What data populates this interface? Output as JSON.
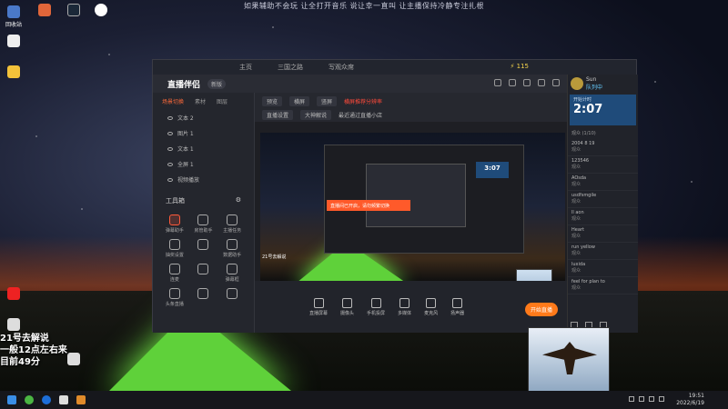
{
  "banner": "如果辅助不会玩 让全打开音乐 说让幸一直叫 让主播保持冷静专注扎根",
  "overlay": {
    "line1": "21号去解说",
    "line2": "一般12点左右来",
    "line3": "目前49分"
  },
  "desktop_icons": [
    {
      "name": "回收站"
    },
    {
      "name": ""
    },
    {
      "name": ""
    },
    {
      "name": ""
    }
  ],
  "app": {
    "title": "直播伴侣",
    "version": "新版",
    "top_tabs": [
      "主页",
      "三国之路",
      "写观众席"
    ],
    "coins": "115",
    "left_tabs": [
      "场景切换",
      "素材",
      "图层"
    ],
    "scenes": [
      "文本 2",
      "图片 1",
      "文本 1",
      "全屏 1",
      "视频播放"
    ],
    "tools_title": "工具箱",
    "tools": [
      {
        "label": "弹幕助手",
        "hot": true
      },
      {
        "label": "房管助手",
        "hot": false
      },
      {
        "label": "主播任务",
        "hot": false
      },
      {
        "label": "抽奖设置",
        "hot": false
      },
      {
        "label": "",
        "hot": false
      },
      {
        "label": "数据助手",
        "hot": false
      },
      {
        "label": "连麦",
        "hot": false
      },
      {
        "label": "",
        "hot": false
      },
      {
        "label": "弹幕框",
        "hot": false
      },
      {
        "label": "头条直播",
        "hot": false
      },
      {
        "label": "",
        "hot": false
      },
      {
        "label": "",
        "hot": false
      }
    ],
    "center_top": {
      "chip1": "预览",
      "chip2": "横屏",
      "chip3": "竖屏",
      "red_text": "横屏推荐分辨率",
      "chip4": "直播设置",
      "chip5": "大神解说",
      "note": "最近通过直播小店"
    },
    "preview": {
      "toast": "直播间已开启，请勿频繁切换",
      "nested_timer": "3:07",
      "label": "21号去解说"
    },
    "bottom_bar": [
      "直播屏幕",
      "摄像头",
      "手机投屏",
      "多媒体",
      "麦克风",
      "扬声器"
    ],
    "start_button": "开始直播",
    "right_panel": {
      "user": "Sun",
      "user_status": "队列中",
      "timer_label": "开始计时",
      "timer": "2:07",
      "chat_header": "观众 (1/10)",
      "chats": [
        {
          "name": "2004 8 19",
          "msg": "观众"
        },
        {
          "name": "123546",
          "msg": "观众"
        },
        {
          "name": "AOsda",
          "msg": "观众"
        },
        {
          "name": "usdfsmgile",
          "msg": "观众"
        },
        {
          "name": "ll aon",
          "msg": "观众"
        },
        {
          "name": "Heart",
          "msg": "观众"
        },
        {
          "name": "run yellow",
          "msg": "观众"
        },
        {
          "name": "luxida",
          "msg": "观众"
        },
        {
          "name": "feel for plan to",
          "msg": "观众"
        }
      ]
    }
  },
  "taskbar": {
    "time": "19:51",
    "date": "2022/6/19"
  }
}
